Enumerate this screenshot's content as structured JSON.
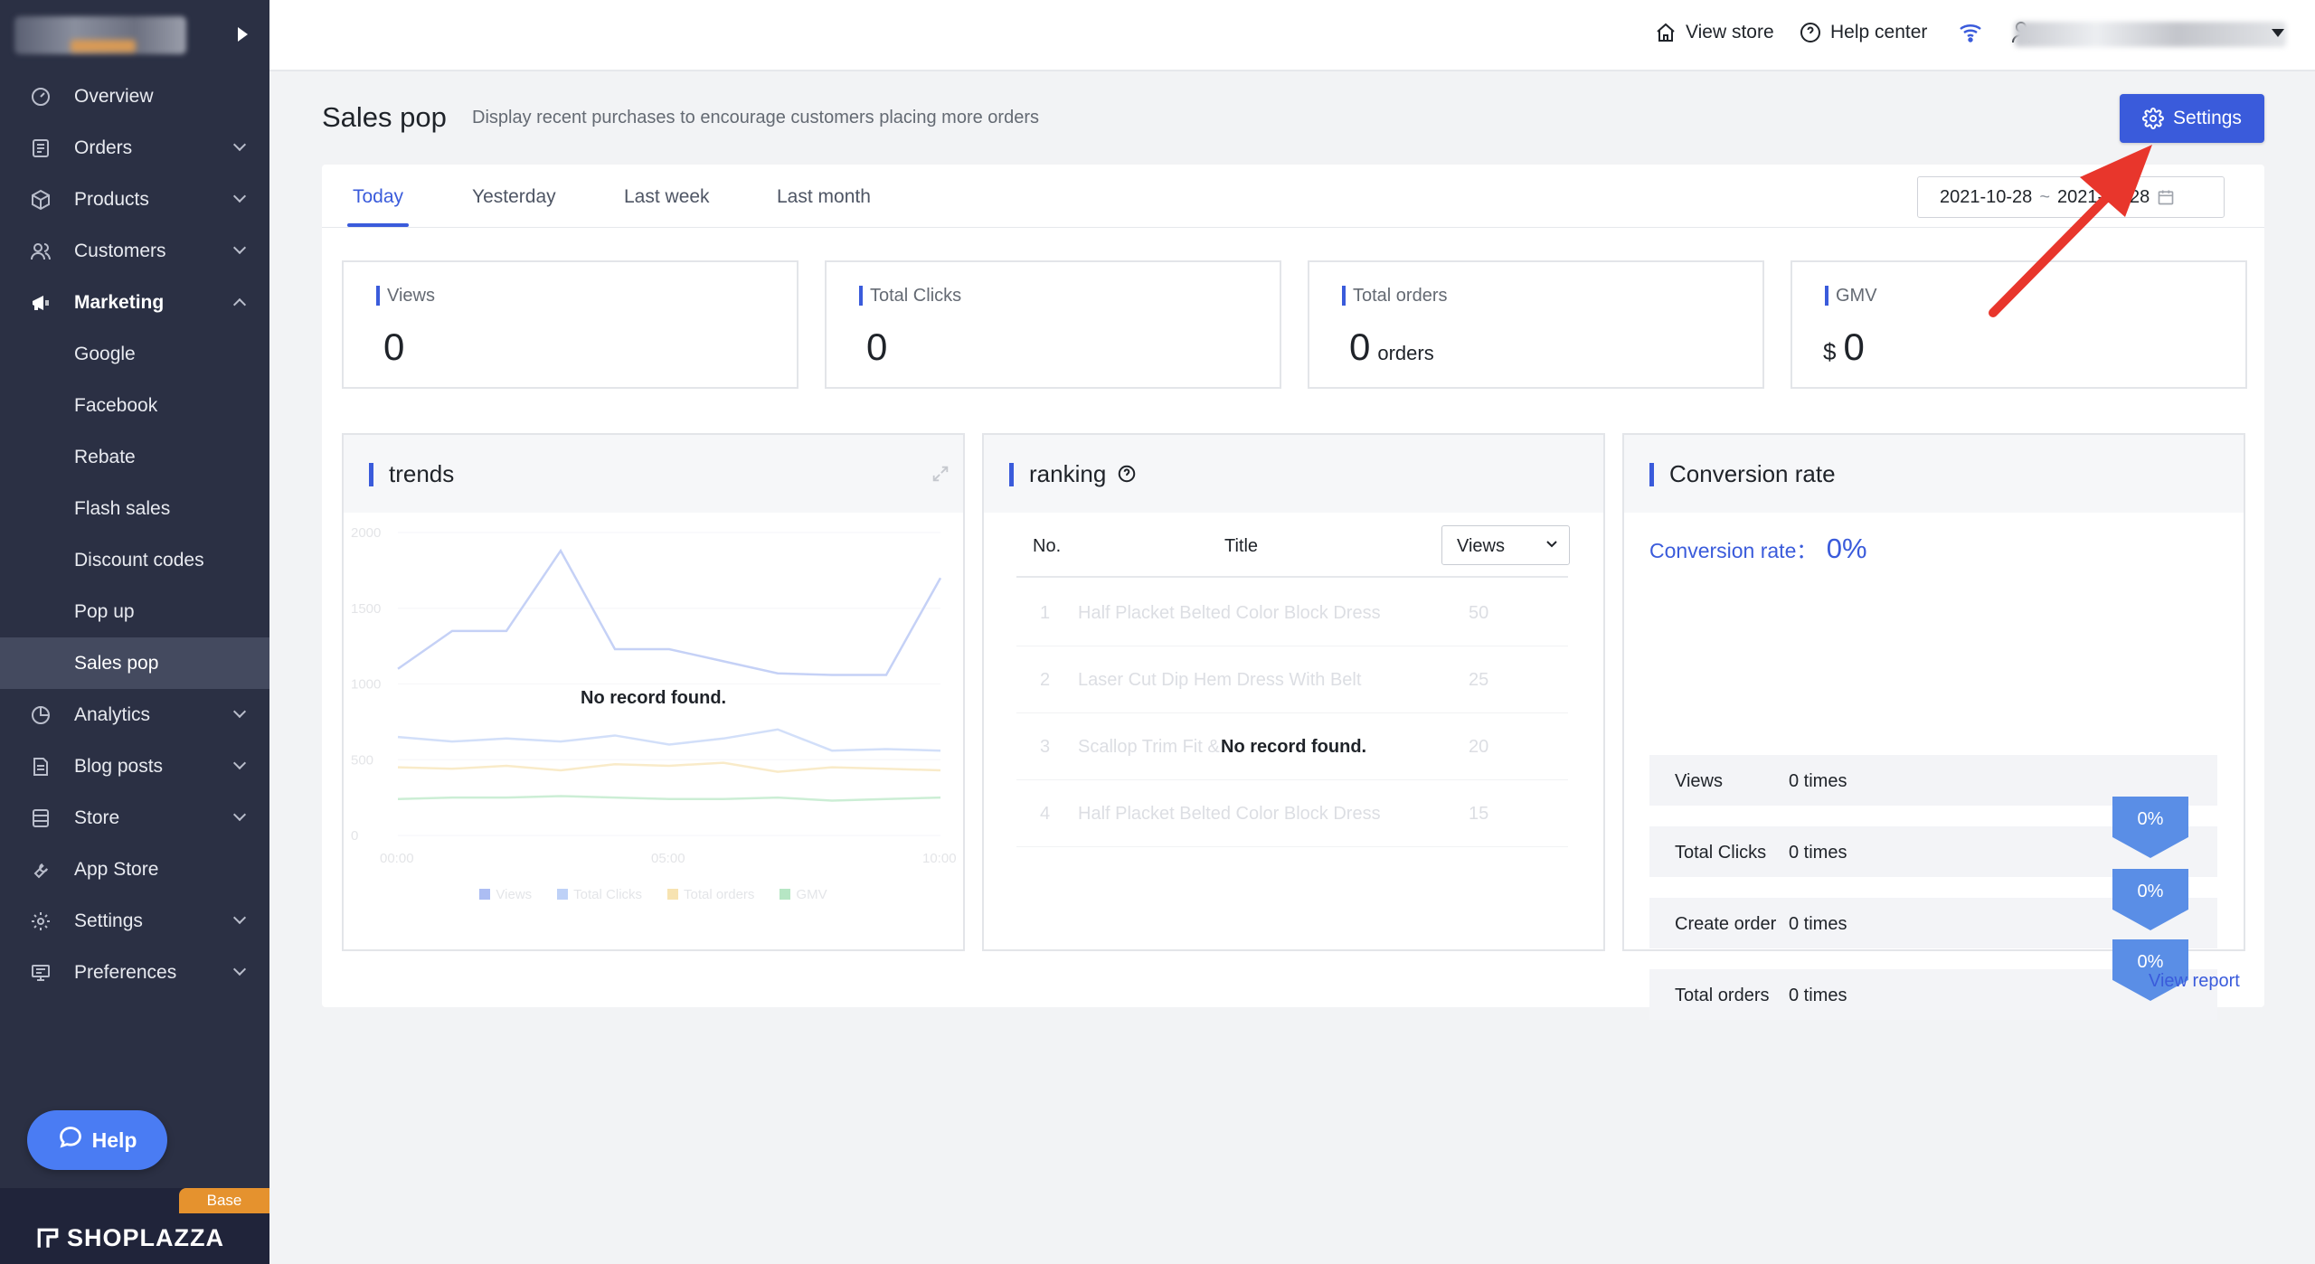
{
  "sidebar": {
    "items": [
      {
        "label": "Overview",
        "icon": "gauge-icon",
        "has_chevron": false
      },
      {
        "label": "Orders",
        "icon": "orders-icon",
        "has_chevron": true
      },
      {
        "label": "Products",
        "icon": "box-icon",
        "has_chevron": true
      },
      {
        "label": "Customers",
        "icon": "users-icon",
        "has_chevron": true
      },
      {
        "label": "Marketing",
        "icon": "megaphone-icon",
        "has_chevron": true,
        "expanded": true
      }
    ],
    "marketing_subitems": [
      "Google",
      "Facebook",
      "Rebate",
      "Flash sales",
      "Discount codes",
      "Pop up",
      "Sales pop"
    ],
    "selected_subitem": "Sales pop",
    "items_after": [
      {
        "label": "Analytics",
        "icon": "pie-chart-icon",
        "has_chevron": true
      },
      {
        "label": "Blog posts",
        "icon": "document-icon",
        "has_chevron": true
      },
      {
        "label": "Store",
        "icon": "store-icon",
        "has_chevron": true
      },
      {
        "label": "App Store",
        "icon": "wrench-icon",
        "has_chevron": false
      },
      {
        "label": "Settings",
        "icon": "gear-icon",
        "has_chevron": true
      },
      {
        "label": "Preferences",
        "icon": "monitor-icon",
        "has_chevron": true
      }
    ],
    "help_label": "Help",
    "plan_badge": "Base",
    "brand": "SHOPLAZZA"
  },
  "topbar": {
    "view_store": "View store",
    "help_center": "Help center"
  },
  "header": {
    "title": "Sales pop",
    "description": "Display recent purchases to encourage customers placing more orders",
    "settings_label": "Settings"
  },
  "tabs": {
    "items": [
      "Today",
      "Yesterday",
      "Last week",
      "Last month"
    ],
    "active": "Today"
  },
  "date_range": {
    "start": "2021-10-28",
    "separator": "~",
    "end": "2021-10-28"
  },
  "stats": [
    {
      "label": "Views",
      "value": "0",
      "unit": "",
      "prefix": ""
    },
    {
      "label": "Total Clicks",
      "value": "0",
      "unit": "",
      "prefix": ""
    },
    {
      "label": "Total orders",
      "value": "0",
      "unit": "orders",
      "prefix": ""
    },
    {
      "label": "GMV",
      "value": "0",
      "unit": "",
      "prefix": "$"
    }
  ],
  "trends": {
    "title": "trends",
    "empty_text": "No record found.",
    "y_ticks": [
      "2000",
      "1500",
      "1000",
      "500",
      "0"
    ],
    "x_ticks": [
      "00:00",
      "05:00",
      "10:00"
    ],
    "legend": [
      "Views",
      "Total Clicks",
      "Total orders",
      "GMV"
    ],
    "legend_colors": [
      "#5b7ee8",
      "#7fa4f0",
      "#f0c866",
      "#6fcf8a"
    ]
  },
  "chart_data": {
    "type": "line",
    "title": "trends",
    "x": [
      "00:00",
      "01:00",
      "02:00",
      "03:00",
      "04:00",
      "05:00",
      "06:00",
      "07:00",
      "08:00",
      "09:00",
      "10:00"
    ],
    "ylim": [
      0,
      2000
    ],
    "series": [
      {
        "name": "Views",
        "values": [
          1100,
          1350,
          1350,
          1880,
          1230,
          1230,
          1150,
          1070,
          1060,
          1060,
          1700
        ]
      },
      {
        "name": "Total Clicks",
        "values": [
          650,
          620,
          640,
          620,
          660,
          600,
          640,
          700,
          560,
          570,
          560
        ]
      },
      {
        "name": "Total orders",
        "values": [
          450,
          440,
          460,
          430,
          470,
          460,
          480,
          420,
          450,
          440,
          430
        ]
      },
      {
        "name": "GMV",
        "values": [
          240,
          250,
          250,
          260,
          250,
          240,
          240,
          250,
          230,
          240,
          250
        ]
      }
    ]
  },
  "ranking": {
    "title": "ranking",
    "col_no": "No.",
    "col_title": "Title",
    "metric_select": "Views",
    "empty_text": "No record found.",
    "rows": [
      {
        "no": "1",
        "title": "Half Placket Belted Color Block Dress",
        "value": "50"
      },
      {
        "no": "2",
        "title": "Laser Cut Dip Hem Dress With Belt",
        "value": "25"
      },
      {
        "no": "3",
        "title": "Scallop Trim Fit &",
        "value": "20"
      },
      {
        "no": "4",
        "title": "Half Placket Belted Color Block Dress",
        "value": "15"
      }
    ]
  },
  "conversion": {
    "title": "Conversion rate",
    "rate_label": "Conversion rate：",
    "rate_value": "0%",
    "rows": [
      {
        "name": "Views",
        "times": "0 times"
      },
      {
        "name": "Total Clicks",
        "times": "0 times"
      },
      {
        "name": "Create order",
        "times": "0 times"
      },
      {
        "name": "Total orders",
        "times": "0 times"
      }
    ],
    "badges": [
      "0%",
      "0%",
      "0%"
    ]
  },
  "footer": {
    "view_report": "View report"
  },
  "colors": {
    "accent": "#3a5bdb",
    "sidebar_bg": "#2b3044",
    "annotation_arrow": "#e8362c"
  }
}
